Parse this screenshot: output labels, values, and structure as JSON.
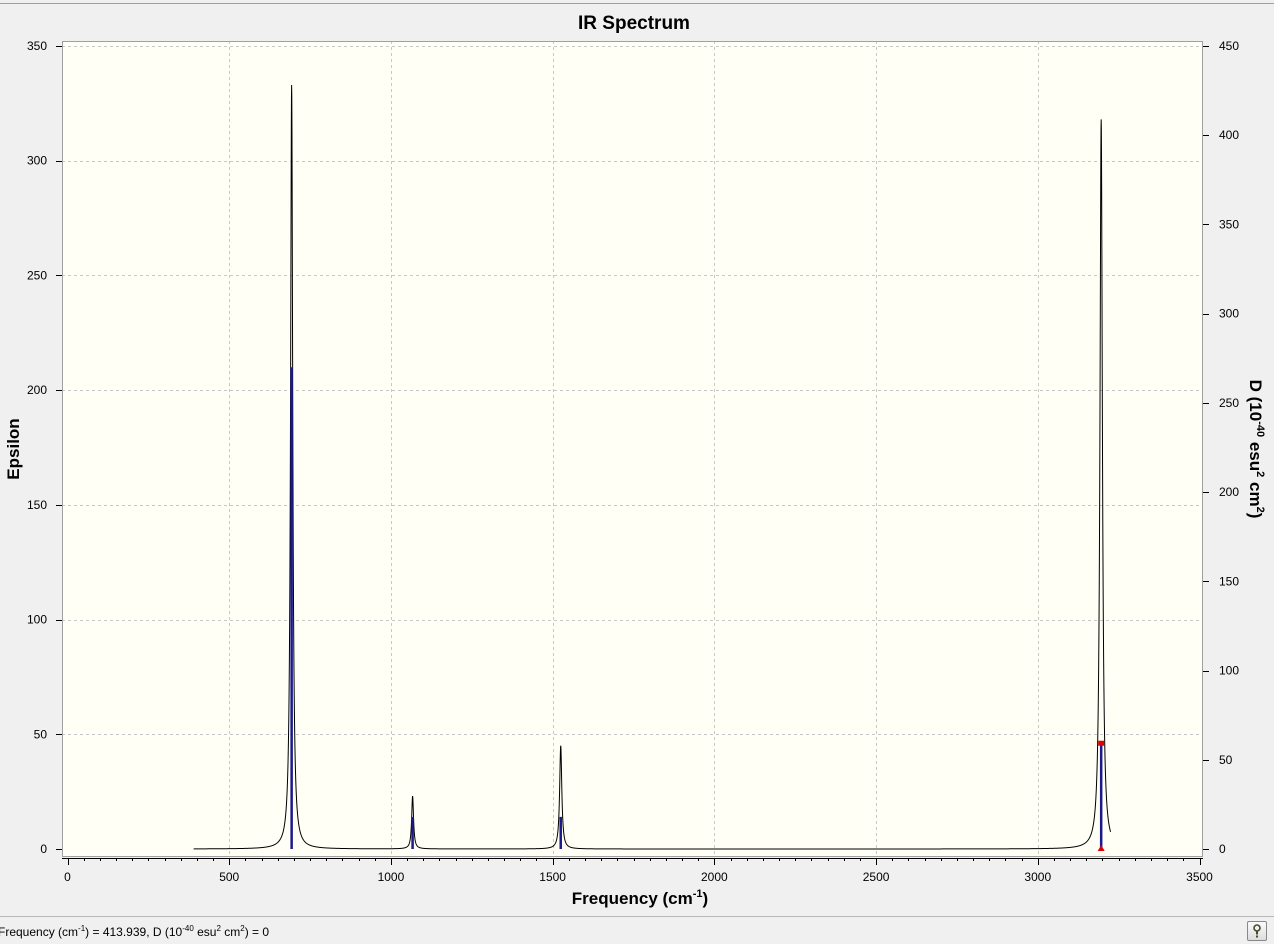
{
  "chart_data": {
    "type": "line",
    "title": "IR Spectrum",
    "xlabel": {
      "main": "Frequency (cm",
      "sup": "-1",
      "end": ")"
    },
    "ylabel_left": "Epsilon",
    "ylabel_right": {
      "p1": "D (10",
      "s1": "-40",
      "p2": " esu",
      "s2": "2",
      "p3": " cm",
      "s3": "2",
      "p4": ")"
    },
    "xlim": [
      0,
      3500
    ],
    "ylim_left": [
      0,
      350
    ],
    "ylim_right": [
      0,
      450
    ],
    "x_ticks": [
      0,
      500,
      1000,
      1500,
      2000,
      2500,
      3000,
      3500
    ],
    "y_ticks_left": [
      0,
      50,
      100,
      150,
      200,
      250,
      300,
      350
    ],
    "y_ticks_right": [
      0,
      50,
      100,
      150,
      200,
      250,
      300,
      350,
      400,
      450
    ],
    "grid": true,
    "spectrum_range": [
      390,
      3225
    ],
    "peaks": [
      {
        "center": 693,
        "epsilon": 333,
        "width": 8
      },
      {
        "center": 1067,
        "epsilon": 23,
        "width": 7
      },
      {
        "center": 1525,
        "epsilon": 45,
        "width": 8
      },
      {
        "center": 3196,
        "epsilon": 318,
        "width": 9
      }
    ],
    "sticks": [
      {
        "x": 693,
        "d": 270
      },
      {
        "x": 1067,
        "d": 18
      },
      {
        "x": 1525,
        "d": 18
      },
      {
        "x": 3196,
        "d": 59
      }
    ],
    "colors": {
      "plot_bg": "#fffff5",
      "grid": "#c8c8c8",
      "curve": "#000000",
      "stick": "#1a1a8c",
      "marker": "#e00000"
    }
  },
  "status": {
    "p1": "Frequency (cm",
    "s1": "-1",
    "p2": ") = 413.939, D (10",
    "s2": "-40",
    "p3": " esu",
    "s3": "2",
    "p4": " cm",
    "s4": "2",
    "p5": ") = 0"
  }
}
